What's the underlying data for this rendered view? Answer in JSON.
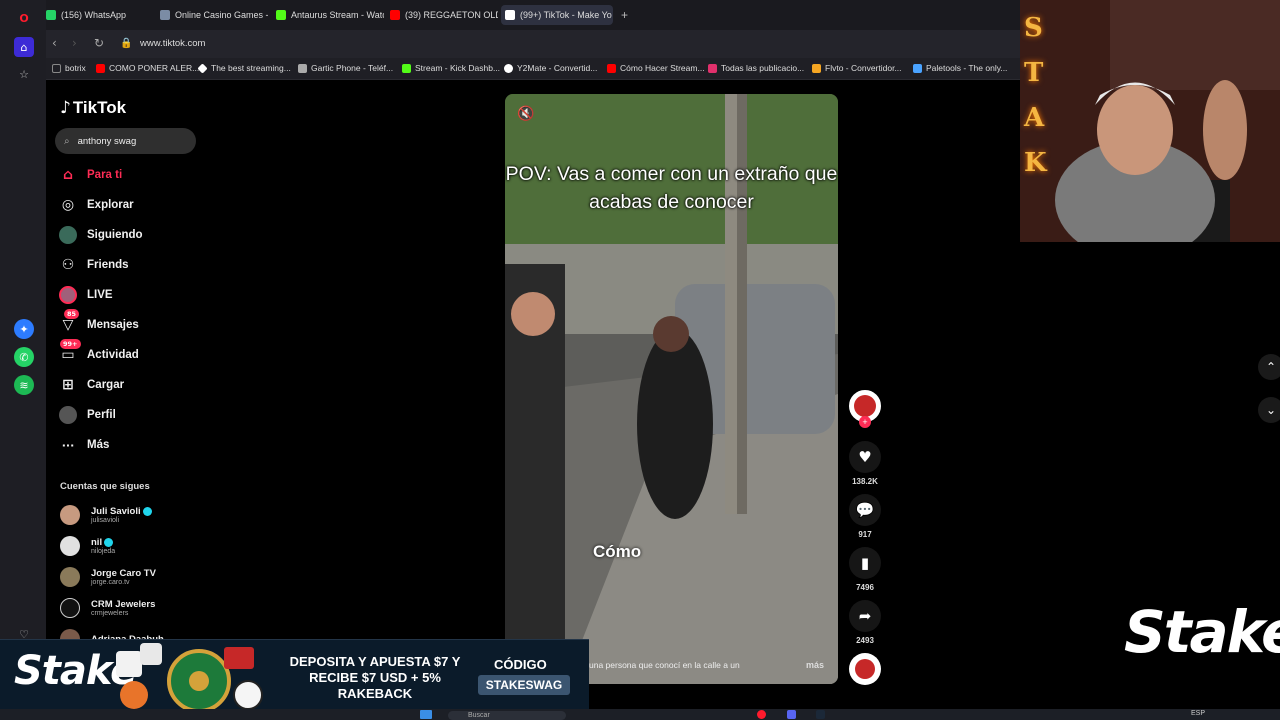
{
  "browser": {
    "tabs": [
      {
        "label": "(156) WhatsApp",
        "color": "#25d366"
      },
      {
        "label": "Online Casino Games - Pl",
        "color": "#7b8ca5"
      },
      {
        "label": "Antaurus Stream - Watch",
        "color": "#53fc18"
      },
      {
        "label": "(39) REGGAETON OLD SC",
        "color": "#ff0000"
      },
      {
        "label": "(99+) TikTok - Make Yo",
        "color": "#ffffff"
      }
    ],
    "new_tab": "+",
    "url": "www.tiktok.com",
    "bookmarks": [
      {
        "label": "botrix",
        "color": "#888888"
      },
      {
        "label": "COMO PONER ALER...",
        "color": "#ff0000"
      },
      {
        "label": "The best streaming...",
        "color": "#ffffff"
      },
      {
        "label": "Gartic Phone - Teléf...",
        "color": "#aaaaaa"
      },
      {
        "label": "Stream - Kick Dashb...",
        "color": "#53fc18"
      },
      {
        "label": "Y2Mate - Convertid...",
        "color": "#ffffff"
      },
      {
        "label": "Cómo Hacer Stream...",
        "color": "#ff0000"
      },
      {
        "label": "Todas las publicacio...",
        "color": "#e1306c"
      },
      {
        "label": "Flvto - Convertidor...",
        "color": "#f5a623"
      },
      {
        "label": "Paletools - The only...",
        "color": "#4aa3ff"
      }
    ]
  },
  "tiktok": {
    "logo": "TikTok",
    "search_value": "anthony swag",
    "nav": [
      {
        "label": "Para ti",
        "icon": "home-icon",
        "glyph": "⌂",
        "active": true
      },
      {
        "label": "Explorar",
        "icon": "compass-icon",
        "glyph": "◎"
      },
      {
        "label": "Siguiendo",
        "icon": "following-icon",
        "glyph": "●"
      },
      {
        "label": "Friends",
        "icon": "friends-icon",
        "glyph": "⚇"
      },
      {
        "label": "LIVE",
        "icon": "live-icon",
        "glyph": "●"
      },
      {
        "label": "Mensajes",
        "icon": "messages-icon",
        "glyph": "▽",
        "badge": "85"
      },
      {
        "label": "Actividad",
        "icon": "activity-icon",
        "glyph": "▭",
        "badge": "99+"
      },
      {
        "label": "Cargar",
        "icon": "upload-icon",
        "glyph": "⊞"
      },
      {
        "label": "Perfil",
        "icon": "profile-icon",
        "glyph": "●"
      },
      {
        "label": "Más",
        "icon": "more-icon",
        "glyph": "···"
      }
    ],
    "following_title": "Cuentas que sigues",
    "accounts": [
      {
        "name": "Juli Savioli",
        "handle": "julisavioli",
        "verified": true,
        "color": "#c79a80"
      },
      {
        "name": "nil",
        "handle": "nilojeda",
        "verified": true,
        "color": "#e0e0e0"
      },
      {
        "name": "Jorge Caro TV",
        "handle": "jorge.caro.tv",
        "verified": false,
        "color": "#8a7a5a"
      },
      {
        "name": "CRM Jewelers",
        "handle": "crmjewelers",
        "verified": false,
        "color": "#111111"
      },
      {
        "name": "Adriana Daabuh",
        "handle": "",
        "verified": false,
        "color": "#7a5a4a"
      }
    ],
    "video": {
      "caption_top": "POV: Vas a comer con un extraño que acabas de conocer",
      "caption_mid": "Cómo",
      "description": "una persona que conocí en la calle a un",
      "more": "más"
    },
    "actions": {
      "likes": "138.2K",
      "comments": "917",
      "saves": "7496",
      "shares": "2493"
    }
  },
  "overlay": {
    "stake_logo": "Stake",
    "webcam_letters": [
      "S",
      "T",
      "A",
      "K"
    ],
    "banner": {
      "logo": "Stake",
      "text": "DEPOSITA Y APUESTA $7 Y RECIBE $7 USD + 5% RAKEBACK",
      "code_label": "CÓDIGO",
      "code": "STAKESWAG"
    }
  },
  "taskbar": {
    "search": "Buscar",
    "lang": "ESP"
  }
}
